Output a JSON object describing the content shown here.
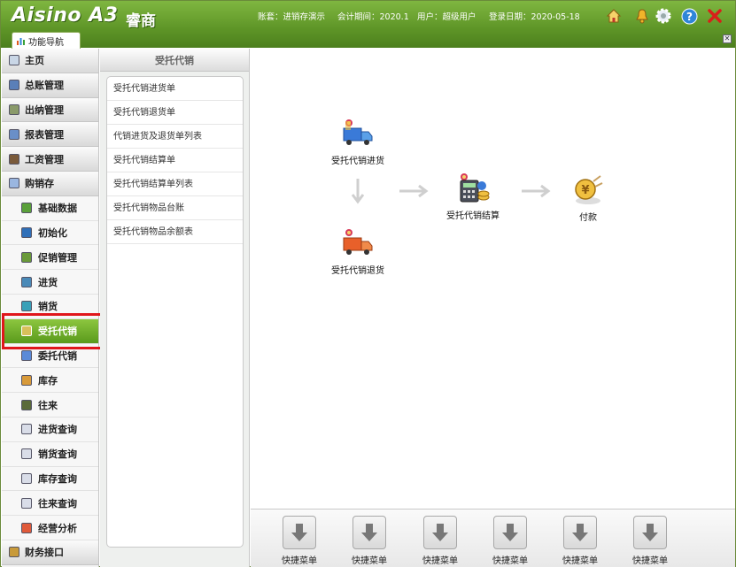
{
  "header": {
    "brand": "Aisino A3",
    "brand_sub": "睿商",
    "account": "账套：进销存演示",
    "period": "会计期间：2020.1",
    "user": "用户：超级用户",
    "login_date": "登录日期：2020-05-18",
    "tab_label": "功能导航",
    "icons": [
      "home-icon",
      "bell-icon",
      "gear-icon",
      "help-icon",
      "close-icon"
    ]
  },
  "sidebar": {
    "items": [
      {
        "label": "主页"
      },
      {
        "label": "总账管理"
      },
      {
        "label": "出纳管理"
      },
      {
        "label": "报表管理"
      },
      {
        "label": "工资管理"
      },
      {
        "label": "购销存"
      }
    ],
    "subitems": [
      {
        "label": "基础数据"
      },
      {
        "label": "初始化"
      },
      {
        "label": "促销管理"
      },
      {
        "label": "进货"
      },
      {
        "label": "销货"
      },
      {
        "label": "受托代销"
      },
      {
        "label": "委托代销"
      },
      {
        "label": "库存"
      },
      {
        "label": "往来"
      },
      {
        "label": "进货查询"
      },
      {
        "label": "销货查询"
      },
      {
        "label": "库存查询"
      },
      {
        "label": "往来查询"
      },
      {
        "label": "经营分析"
      }
    ],
    "bottom": {
      "label": "财务接口"
    },
    "active_color": "#6aaa28",
    "highlight_color": "#e0161b"
  },
  "subpanel": {
    "title": "受托代销",
    "items": [
      "受托代销进货单",
      "受托代销退货单",
      "代销进货及退货单列表",
      "受托代销结算单",
      "受托代销结算单列表",
      "受托代销物品台账",
      "受托代销物品余额表"
    ]
  },
  "workflow": {
    "in": "受托代销进货",
    "return": "受托代销退货",
    "settle": "受托代销结算",
    "pay": "付款"
  },
  "quickbar": {
    "label": "快捷菜单",
    "count": 6
  }
}
